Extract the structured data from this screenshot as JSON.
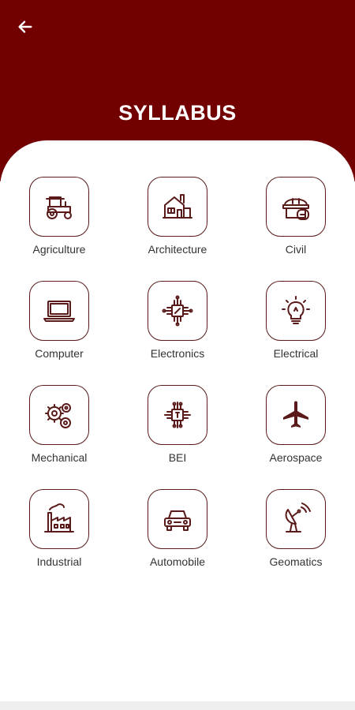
{
  "header": {
    "title": "SYLLABUS",
    "back_icon": "arrow-left-icon",
    "background": "#720000"
  },
  "colors": {
    "icon_stroke": "#5a1a1a",
    "label_text": "#333333"
  },
  "items": [
    {
      "label": "Agriculture",
      "icon": "tractor-icon"
    },
    {
      "label": "Architecture",
      "icon": "house-icon"
    },
    {
      "label": "Civil",
      "icon": "helmet-icon"
    },
    {
      "label": "Computer",
      "icon": "laptop-icon"
    },
    {
      "label": "Electronics",
      "icon": "chip-icon"
    },
    {
      "label": "Electrical",
      "icon": "bulb-icon"
    },
    {
      "label": "Mechanical",
      "icon": "gears-icon"
    },
    {
      "label": "BEI",
      "icon": "circuit-icon"
    },
    {
      "label": "Aerospace",
      "icon": "airplane-icon"
    },
    {
      "label": "Industrial",
      "icon": "factory-icon"
    },
    {
      "label": "Automobile",
      "icon": "car-icon"
    },
    {
      "label": "Geomatics",
      "icon": "satellite-dish-icon"
    }
  ]
}
